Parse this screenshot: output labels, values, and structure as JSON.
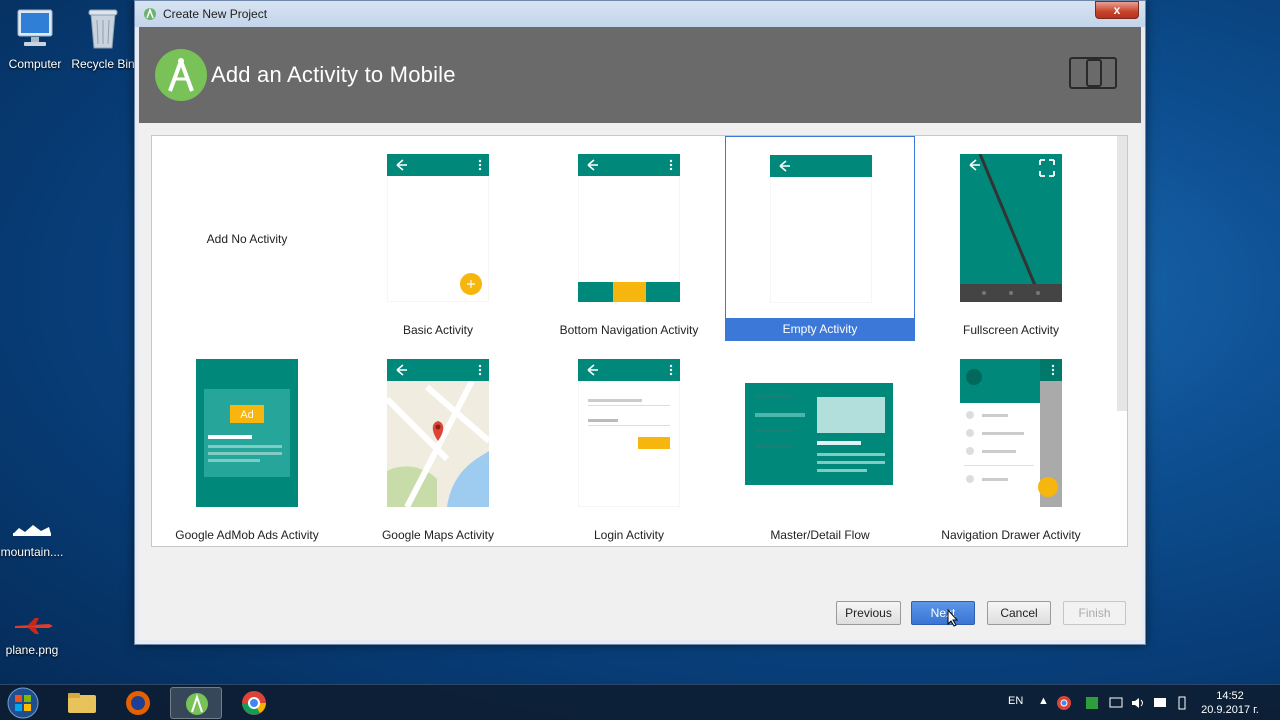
{
  "desktop": {
    "icons": [
      {
        "label": "Computer"
      },
      {
        "label": "Recycle Bin"
      },
      {
        "label": "mountain...."
      },
      {
        "label": "plane.png"
      }
    ]
  },
  "window": {
    "title": "Create New Project",
    "close_label": "x",
    "header_title": "Add an Activity to Mobile",
    "accent": "#00897b"
  },
  "templates": [
    {
      "label": "Add No Activity"
    },
    {
      "label": "Basic Activity"
    },
    {
      "label": "Bottom Navigation Activity"
    },
    {
      "label": "Empty Activity",
      "selected": true
    },
    {
      "label": "Fullscreen Activity"
    },
    {
      "label": "Google AdMob Ads Activity",
      "ad_text": "Ad"
    },
    {
      "label": "Google Maps Activity"
    },
    {
      "label": "Login Activity"
    },
    {
      "label": "Master/Detail Flow"
    },
    {
      "label": "Navigation Drawer Activity"
    }
  ],
  "buttons": {
    "previous": "Previous",
    "next": "Next",
    "cancel": "Cancel",
    "finish": "Finish"
  },
  "taskbar": {
    "language": "EN",
    "time": "14:52",
    "date": "20.9.2017 г."
  }
}
